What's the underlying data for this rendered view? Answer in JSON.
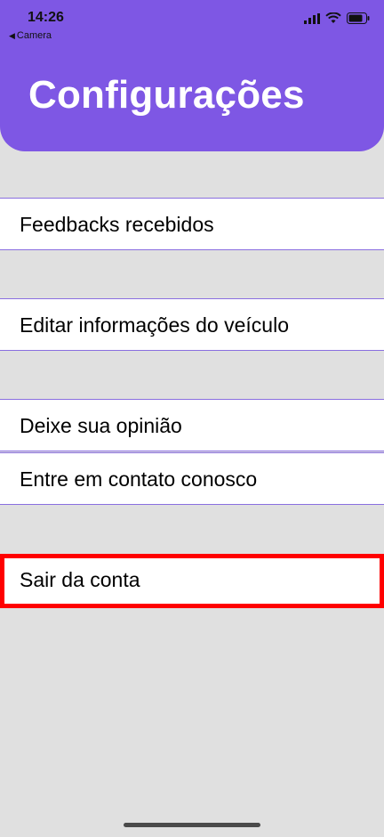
{
  "status_bar": {
    "time": "14:26",
    "back_app": "Camera"
  },
  "header": {
    "title": "Configurações",
    "background_color": "#7e57e4"
  },
  "settings": {
    "items": [
      {
        "label": "Feedbacks recebidos"
      },
      {
        "label": "Editar informações do veículo"
      },
      {
        "label": "Deixe sua opinião"
      },
      {
        "label": "Entre em contato conosco"
      },
      {
        "label": "Sair da conta"
      }
    ]
  },
  "colors": {
    "accent": "#7e57e4",
    "highlight_border": "#ff0000",
    "page_background": "#e0e0e0"
  }
}
